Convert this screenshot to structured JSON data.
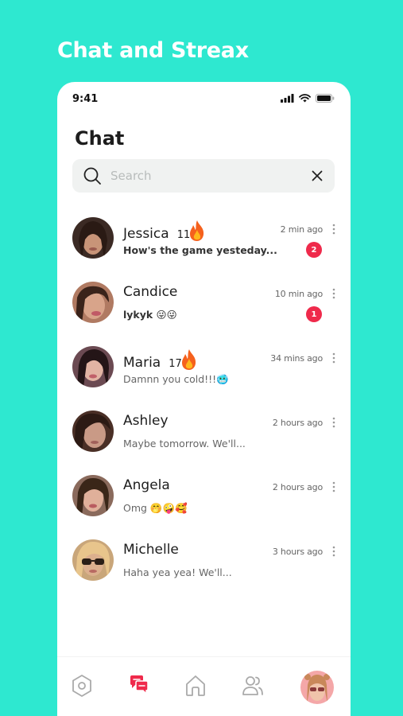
{
  "headline": "Chat and Streax",
  "status_bar": {
    "time": "9:41"
  },
  "screen_title": "Chat",
  "search": {
    "placeholder": "Search",
    "value": ""
  },
  "chats": [
    {
      "name": "Jessica",
      "streak": "11",
      "preview": "How's the game yesteday...",
      "time": "2 min ago",
      "unread": "2",
      "bold": true
    },
    {
      "name": "Candice",
      "streak": "",
      "preview": "lykyk 😜😜",
      "time": "10 min ago",
      "unread": "1",
      "bold": true
    },
    {
      "name": "Maria",
      "streak": "17",
      "preview": "Damnn you cold!!!🥶",
      "time": "34 mins ago",
      "unread": "",
      "bold": false
    },
    {
      "name": "Ashley",
      "streak": "",
      "preview": "Maybe tomorrow. We'll...",
      "time": "2 hours ago",
      "unread": "",
      "bold": false
    },
    {
      "name": "Angela",
      "streak": "",
      "preview": "Omg 🤭🤪🥰",
      "time": "2 hours ago",
      "unread": "",
      "bold": false
    },
    {
      "name": "Michelle",
      "streak": "",
      "preview": "Haha yea yea! We'll...",
      "time": "3 hours ago",
      "unread": "",
      "bold": false
    }
  ],
  "tabs": [
    {
      "icon": "hexagon-icon",
      "active": false
    },
    {
      "icon": "chat-bubbles-icon",
      "active": true
    },
    {
      "icon": "home-icon",
      "active": false
    },
    {
      "icon": "people-icon",
      "active": false
    },
    {
      "icon": "profile-avatar",
      "active": false
    }
  ],
  "colors": {
    "background": "#2ee8d0",
    "accent": "#ef2a4b",
    "card": "#ffffff",
    "search_bg": "#f0f2f1"
  }
}
